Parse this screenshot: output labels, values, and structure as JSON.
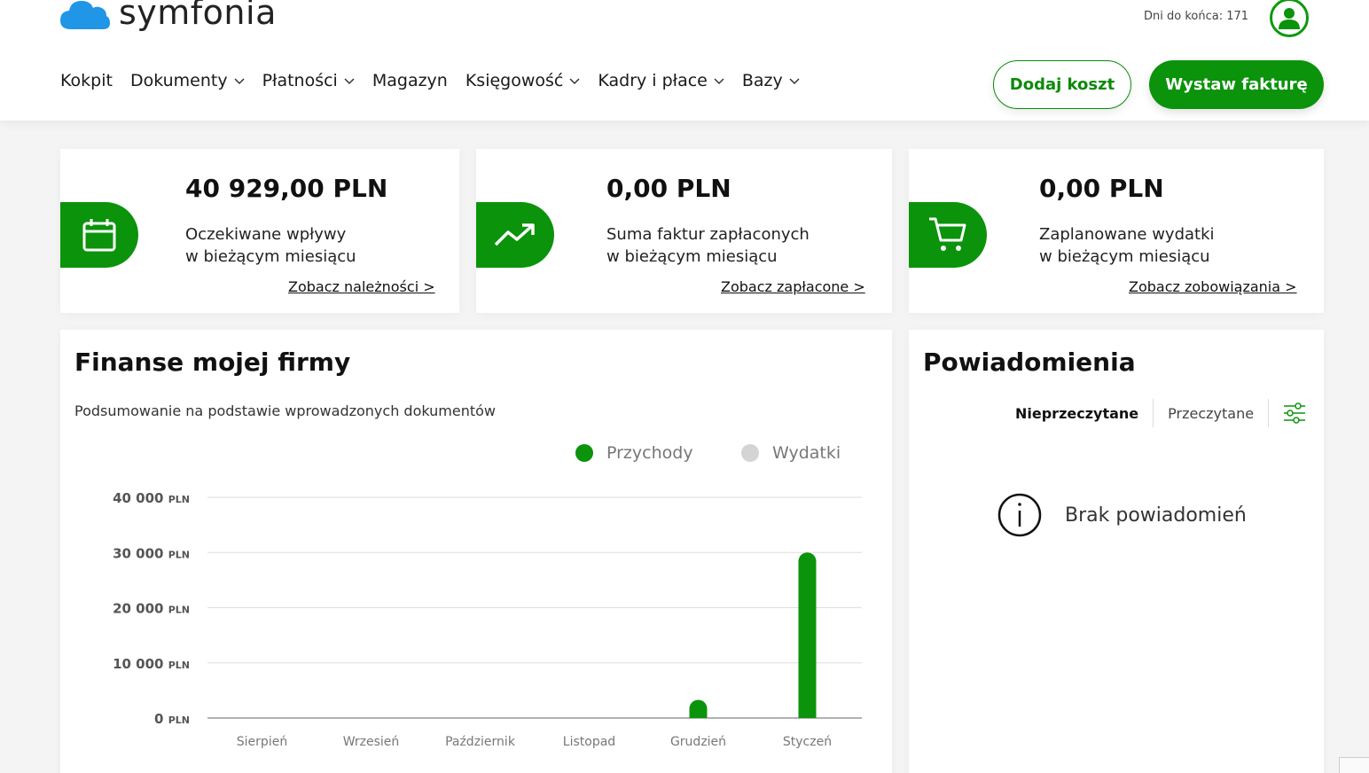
{
  "header": {
    "logo_text": "symfonia",
    "trial_text": "Dni do końca: 171",
    "nav": [
      {
        "label": "Kokpit",
        "has_dropdown": false
      },
      {
        "label": "Dokumenty",
        "has_dropdown": true
      },
      {
        "label": "Płatności",
        "has_dropdown": true
      },
      {
        "label": "Magazyn",
        "has_dropdown": false
      },
      {
        "label": "Księgowość",
        "has_dropdown": true
      },
      {
        "label": "Kadry i płace",
        "has_dropdown": true
      },
      {
        "label": "Bazy",
        "has_dropdown": true
      }
    ],
    "add_cost_label": "Dodaj koszt",
    "issue_invoice_label": "Wystaw fakturę"
  },
  "kpis": [
    {
      "amount": "40 929,00 PLN",
      "desc_line1": "Oczekiwane wpływy",
      "desc_line2": "w bieżącym miesiącu",
      "link": "Zobacz należności >",
      "icon": "calendar-icon"
    },
    {
      "amount": "0,00 PLN",
      "desc_line1": "Suma faktur zapłaconych",
      "desc_line2": "w bieżącym miesiącu",
      "link": "Zobacz zapłacone >",
      "icon": "trending-up-icon"
    },
    {
      "amount": "0,00 PLN",
      "desc_line1": "Zaplanowane wydatki",
      "desc_line2": "w bieżącym miesiącu",
      "link": "Zobacz zobowiązania >",
      "icon": "cart-icon"
    }
  ],
  "finance": {
    "title": "Finanse mojej firmy",
    "subtitle": "Podsumowanie na podstawie wprowadzonych dokumentów"
  },
  "chart_data": {
    "type": "bar",
    "categories": [
      "Sierpień",
      "Wrzesień",
      "Październik",
      "Listopad",
      "Grudzień",
      "Styczeń"
    ],
    "series": [
      {
        "name": "Przychody",
        "color": "#0b930b",
        "values": [
          0,
          0,
          0,
          0,
          3300,
          30000
        ]
      },
      {
        "name": "Wydatki",
        "color": "#d4d4d4",
        "values": [
          0,
          0,
          0,
          0,
          0,
          0
        ]
      }
    ],
    "yticks": [
      {
        "value": 0,
        "num": "0",
        "unit": "PLN"
      },
      {
        "value": 10000,
        "num": "10 000",
        "unit": "PLN"
      },
      {
        "value": 20000,
        "num": "20 000",
        "unit": "PLN"
      },
      {
        "value": 30000,
        "num": "30 000",
        "unit": "PLN"
      },
      {
        "value": 40000,
        "num": "40 000",
        "unit": "PLN"
      }
    ],
    "ylim": [
      0,
      40000
    ],
    "grid": true,
    "legend_position": "top-right"
  },
  "notifications": {
    "title": "Powiadomienia",
    "tab_unread": "Nieprzeczytane",
    "tab_read": "Przeczytane",
    "empty_text": "Brak powiadomień"
  },
  "colors": {
    "brand_green": "#0b930b",
    "logo_blue": "#2196e6"
  }
}
